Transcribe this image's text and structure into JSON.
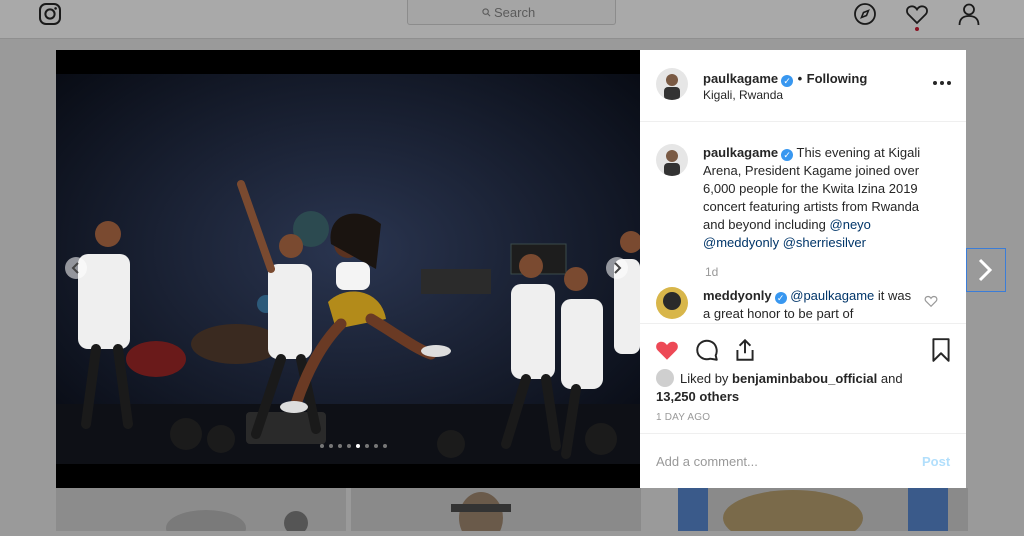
{
  "nav": {
    "search_placeholder": "Search",
    "icons": [
      "instagram-logo-icon",
      "search-icon",
      "explore-compass-icon",
      "activity-heart-icon",
      "profile-icon"
    ]
  },
  "post": {
    "header": {
      "username": "paulkagame",
      "separator": "•",
      "follow_state": "Following",
      "location": "Kigali, Rwanda"
    },
    "caption": {
      "username": "paulkagame",
      "text": "This evening at Kigali Arena, President Kagame joined over 6,000 people for the Kwita Izina 2019 concert featuring artists from Rwanda and beyond including",
      "mentions": [
        "@neyo",
        "@meddyonly",
        "@sherriesilver"
      ],
      "time": "1d"
    },
    "reply": {
      "username": "meddyonly",
      "mention": "@paulkagame",
      "text": "it was a great honor to be part of"
    },
    "likes": {
      "prefix": "Liked by",
      "user": "benjaminbabou_official",
      "and": "and",
      "others": "13,250 others"
    },
    "posted_ago": "1 DAY AGO",
    "comment_placeholder": "Add a comment...",
    "post_label": "Post",
    "carousel": {
      "count": 8,
      "active_index": 4
    }
  },
  "colors": {
    "like_red": "#ed4956",
    "verified_blue": "#3897f0",
    "link_blue": "#003569",
    "post_disabled": "#b2dffc"
  }
}
